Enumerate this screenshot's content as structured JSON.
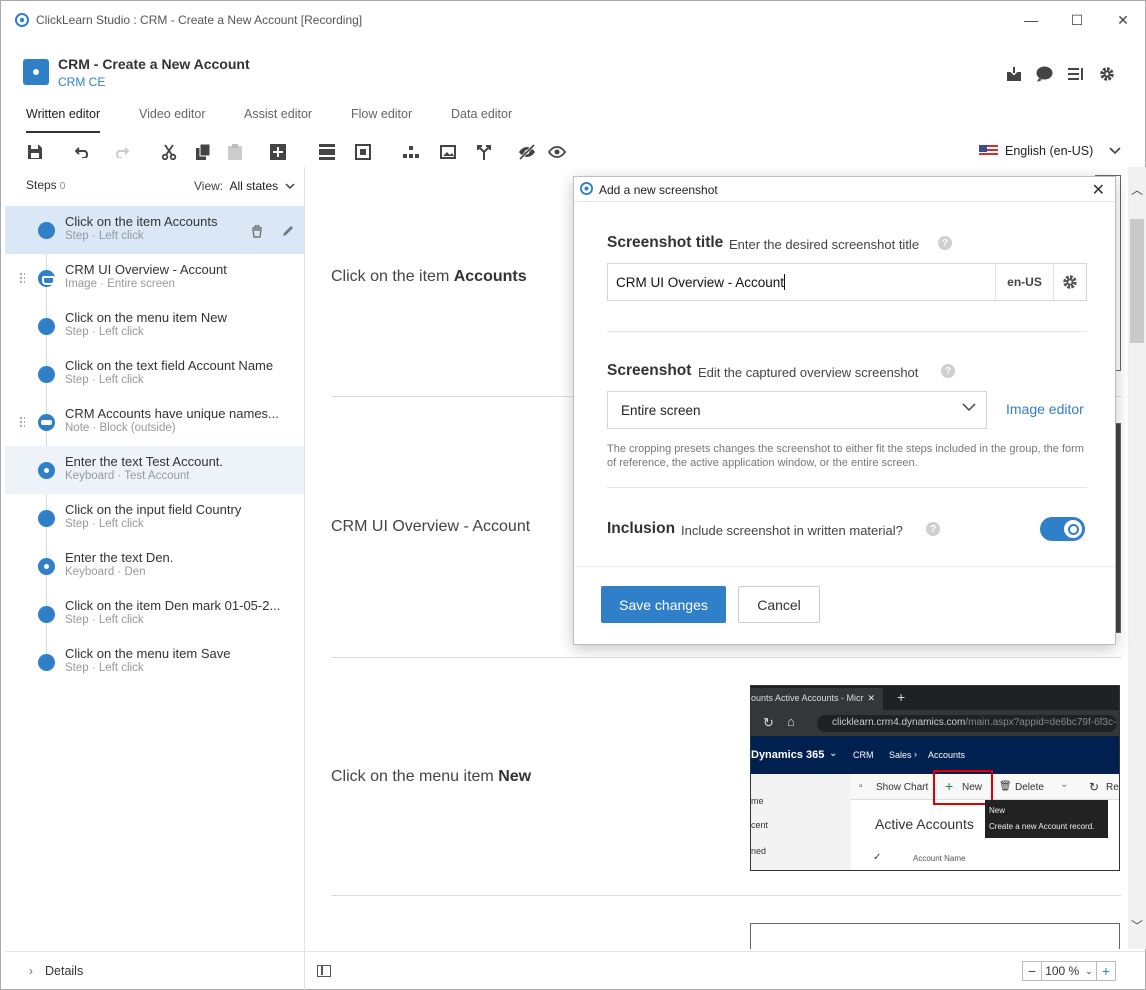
{
  "window": {
    "title": "ClickLearn Studio : CRM - Create a New Account [Recording]",
    "controls": {
      "minimize": "—",
      "maximize": "☐",
      "close": "✕"
    }
  },
  "header": {
    "doc_title": "CRM - Create a New Account",
    "doc_subtitle": "CRM CE",
    "icons": [
      "download-icon",
      "comment-icon",
      "outline-icon",
      "gear-icon"
    ]
  },
  "tabs": [
    {
      "label": "Written editor",
      "active": true
    },
    {
      "label": "Video editor",
      "active": false
    },
    {
      "label": "Assist editor",
      "active": false
    },
    {
      "label": "Flow editor",
      "active": false
    },
    {
      "label": "Data editor",
      "active": false
    }
  ],
  "toolbar": {
    "language": "English (en-US)"
  },
  "sidebar": {
    "steps_label": "Steps",
    "steps_count": "0",
    "view_label": "View:",
    "view_value": "All states",
    "steps": [
      {
        "label": "Click on the item Accounts",
        "sub": "Step · Left click",
        "kind": "step"
      },
      {
        "label": "CRM UI Overview - Account",
        "sub": "Image · Entire screen",
        "kind": "img"
      },
      {
        "label": "Click on the menu item New",
        "sub": "Step · Left click",
        "kind": "step"
      },
      {
        "label": "Click on the text field Account Name",
        "sub": "Step · Left click",
        "kind": "step"
      },
      {
        "label": "CRM Accounts have unique names...",
        "sub": "Note · Block (outside)",
        "kind": "note"
      },
      {
        "label": "Enter the text Test Account.",
        "sub": "Keyboard · Test Account",
        "kind": "kb"
      },
      {
        "label": "Click on the input field Country",
        "sub": "Step · Left click",
        "kind": "step"
      },
      {
        "label": "Enter the text Den.",
        "sub": "Keyboard · Den",
        "kind": "kb"
      },
      {
        "label": "Click on the item Den mark 01-05-2...",
        "sub": "Step · Left click",
        "kind": "step"
      },
      {
        "label": "Click on the menu item Save",
        "sub": "Step · Left click",
        "kind": "step"
      }
    ],
    "details_label": "Details"
  },
  "content": {
    "step1_prefix": "Click on the item ",
    "step1_bold": "Accounts",
    "step2_text": "CRM UI Overview - Account",
    "step3_prefix": "Click on the menu item ",
    "step3_bold": "New"
  },
  "embedded_screenshot": {
    "tab_title": "ounts Active Accounts - Micr",
    "url_host": "clicklearn.crm4.dynamics.com",
    "url_path": "/main.aspx?appid=de6bc79f-6f3c-e",
    "app_name": "Dynamics 365",
    "crumb1": "CRM",
    "crumb2": "Sales",
    "crumb3": "Accounts",
    "show_chart": "Show Chart",
    "new_label": "New",
    "delete_label": "Delete",
    "refresh_label": "Re",
    "left1": "me",
    "left2": "cent",
    "left3": "ned",
    "heading": "Active Accounts",
    "column": "Account Name",
    "tooltip_title": "New",
    "tooltip_text": "Create a new Account record."
  },
  "dialog": {
    "title": "Add a new screenshot",
    "section1_title": "Screenshot title",
    "section1_desc": "Enter the desired screenshot title",
    "title_value": "CRM UI Overview - Account",
    "lang_code": "en-US",
    "section2_title": "Screenshot",
    "section2_desc": "Edit the captured overview screenshot",
    "preset_value": "Entire screen",
    "image_editor_label": "Image editor",
    "hint": "The cropping presets changes the screenshot to either fit the steps included in the group, the form of reference, the active application window, or the entire screen.",
    "section3_title": "Inclusion",
    "section3_desc": "Include screenshot in written material?",
    "inclusion_on": true,
    "save_label": "Save changes",
    "cancel_label": "Cancel"
  },
  "zoom": {
    "minus": "−",
    "value": "100 %",
    "plus": "+"
  },
  "colors": {
    "accent": "#2f7fc9",
    "selected_row": "#d9e7f6",
    "nav_bg": "#002050"
  }
}
